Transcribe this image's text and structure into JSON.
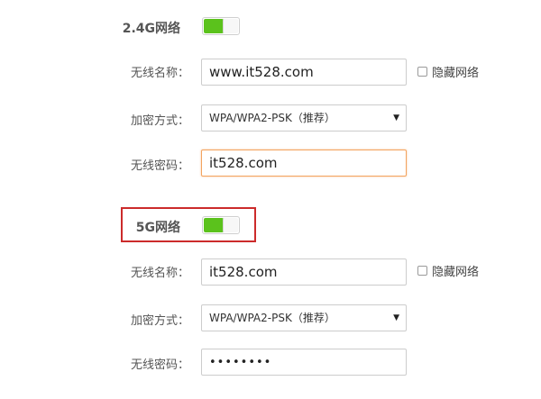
{
  "colors": {
    "toggle_on": "#5bc21c",
    "highlight": "#cc2b2b",
    "focus_border": "#f3a45f"
  },
  "band_24g": {
    "title": "2.4G网络",
    "enabled": true,
    "ssid_label": "无线名称：",
    "ssid_value": "www.it528.com",
    "hide_label": "隐藏网络",
    "hide_checked": false,
    "security_label": "加密方式：",
    "security_value": "WPA/WPA2-PSK（推荐）",
    "password_label": "无线密码：",
    "password_value": "it528.com"
  },
  "band_5g": {
    "title": "5G网络",
    "enabled": true,
    "ssid_label": "无线名称：",
    "ssid_value": "it528.com",
    "hide_label": "隐藏网络",
    "hide_checked": false,
    "security_label": "加密方式：",
    "security_value": "WPA/WPA2-PSK（推荐）",
    "password_label": "无线密码：",
    "password_value": "••••••••"
  }
}
